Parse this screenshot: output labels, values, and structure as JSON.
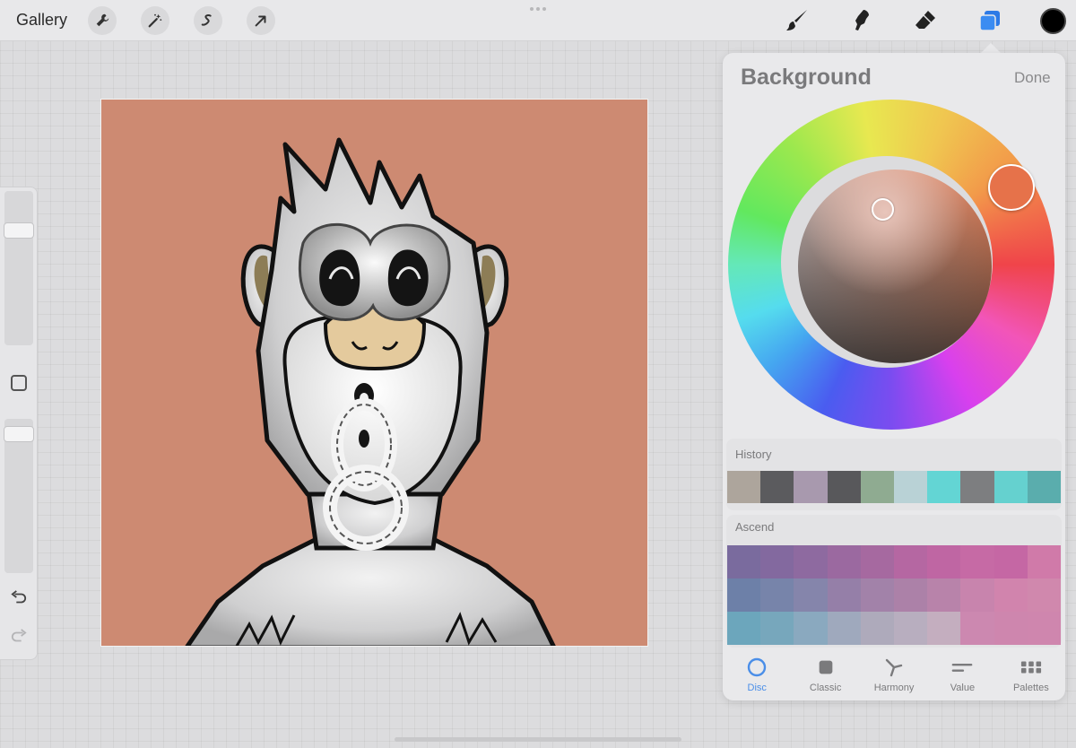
{
  "topbar": {
    "gallery_label": "Gallery",
    "left_tools": [
      "wrench-icon",
      "magic-wand-icon",
      "selection-icon",
      "transform-arrow-icon"
    ],
    "right_tools": [
      "brush-icon",
      "smudge-icon",
      "eraser-icon",
      "layers-icon"
    ],
    "active_tool": "layers-icon",
    "current_color": "#000000"
  },
  "sidebar": {
    "brush_size_level": 0.77,
    "opacity_level": 0.95
  },
  "canvas": {
    "background_color": "#cd8a72"
  },
  "color_panel": {
    "title": "Background",
    "done_label": "Done",
    "selected_hue_color": "#e6724a",
    "history_label": "History",
    "history_colors": [
      "#ada59c",
      "#5b5b5e",
      "#a899ae",
      "#58585b",
      "#8fab91",
      "#b9d2d6",
      "#63d5d4",
      "#7d7e80",
      "#65d1cf",
      "#5aadad"
    ],
    "palette_label": "Ascend",
    "palette_colors": [
      "#7a6b9e",
      "#83699f",
      "#8e6aa0",
      "#9b69a0",
      "#a669a0",
      "#b567a2",
      "#bf66a3",
      "#c66aa5",
      "#c567a4",
      "#d07aa9",
      "#6d80a8",
      "#7784aa",
      "#8585ab",
      "#957fa8",
      "#a282a9",
      "#ac81a8",
      "#b883aa",
      "#c884ad",
      "#d184ad",
      "#d088ad",
      "#6ca6bc",
      "#77a7bc",
      "#8aa9bf",
      "#9fa9bd",
      "#aeaabb",
      "#b8aebf",
      "#c4aebf",
      "#cc88b0",
      "#ce86ae",
      "#cf86ae"
    ],
    "tabs": [
      {
        "label": "Disc",
        "icon": "disc-icon"
      },
      {
        "label": "Classic",
        "icon": "classic-square-icon"
      },
      {
        "label": "Harmony",
        "icon": "harmony-icon"
      },
      {
        "label": "Value",
        "icon": "value-sliders-icon"
      },
      {
        "label": "Palettes",
        "icon": "palettes-grid-icon"
      }
    ],
    "active_tab": "Disc"
  }
}
